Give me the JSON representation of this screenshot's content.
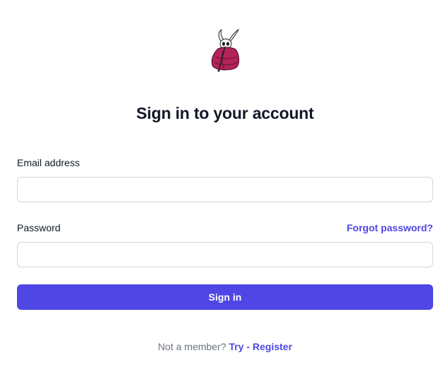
{
  "logo": {
    "name": "hollow-knight-hornet-logo"
  },
  "page": {
    "title": "Sign in to your account"
  },
  "form": {
    "email_label": "Email address",
    "email_value": "",
    "password_label": "Password",
    "password_value": "",
    "forgot_password": "Forgot password?",
    "submit_label": "Sign in"
  },
  "footer": {
    "prompt": "Not a member?",
    "register_link": "Try - Register"
  },
  "colors": {
    "accent": "#4f46e5",
    "text": "#111827",
    "muted": "#6b7280",
    "border": "#d1d5db"
  }
}
